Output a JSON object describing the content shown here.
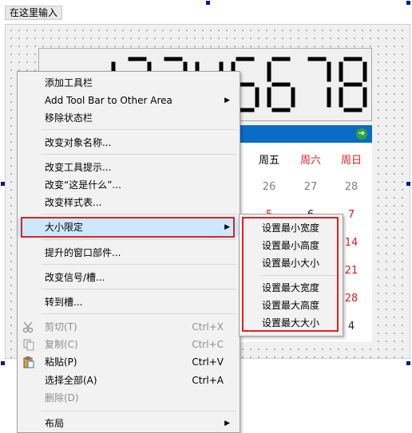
{
  "designer": {
    "type_here_label": "在这里输入"
  },
  "lcd": {
    "value": "1234S678"
  },
  "calendar": {
    "headers": [
      {
        "label": "周五",
        "weekend": false
      },
      {
        "label": "周六",
        "weekend": true
      },
      {
        "label": "周日",
        "weekend": true
      }
    ],
    "rows": [
      [
        "26",
        "27",
        "28"
      ],
      [
        "5",
        "6",
        "7"
      ],
      [
        "",
        "",
        "14"
      ],
      [
        "",
        "",
        "21"
      ],
      [
        "",
        "",
        "28"
      ],
      [
        "",
        "",
        "4"
      ]
    ],
    "next_icon": "arrow-right-icon",
    "nav_color": "#0a6cc4",
    "weekend_color": "#d81e1e"
  },
  "context_menu": {
    "items": [
      {
        "label": "添加工具栏"
      },
      {
        "label": "Add Tool Bar to Other Area",
        "submenu": true
      },
      {
        "label": "移除状态栏"
      },
      {
        "label": "改变对象名称..."
      },
      {
        "label": "改变工具提示..."
      },
      {
        "label": "改变“这是什么”..."
      },
      {
        "label": "改变样式表..."
      },
      {
        "label": "大小限定",
        "submenu": true,
        "highlighted": true
      },
      {
        "label": "提升的窗口部件..."
      },
      {
        "label": "改变信号/槽..."
      },
      {
        "label": "转到槽..."
      },
      {
        "label": "剪切(T)",
        "shortcut": "Ctrl+X",
        "disabled": true,
        "icon": "scissors-icon"
      },
      {
        "label": "复制(C)",
        "shortcut": "Ctrl+C",
        "disabled": true,
        "icon": "copy-icon"
      },
      {
        "label": "粘贴(P)",
        "shortcut": "Ctrl+V",
        "icon": "paste-icon"
      },
      {
        "label": "选择全部(A)",
        "shortcut": "Ctrl+A"
      },
      {
        "label": "删除(D)",
        "disabled": true
      },
      {
        "label": "布局",
        "submenu": true
      }
    ],
    "highlight_color": "#cce8ff",
    "outline_color": "#e02020"
  },
  "submenu": {
    "items": [
      {
        "label": "设置最小宽度"
      },
      {
        "label": "设置最小高度"
      },
      {
        "label": "设置最小大小"
      },
      {
        "label": "设置最大宽度"
      },
      {
        "label": "设置最大高度"
      },
      {
        "label": "设置最大大小"
      }
    ]
  }
}
